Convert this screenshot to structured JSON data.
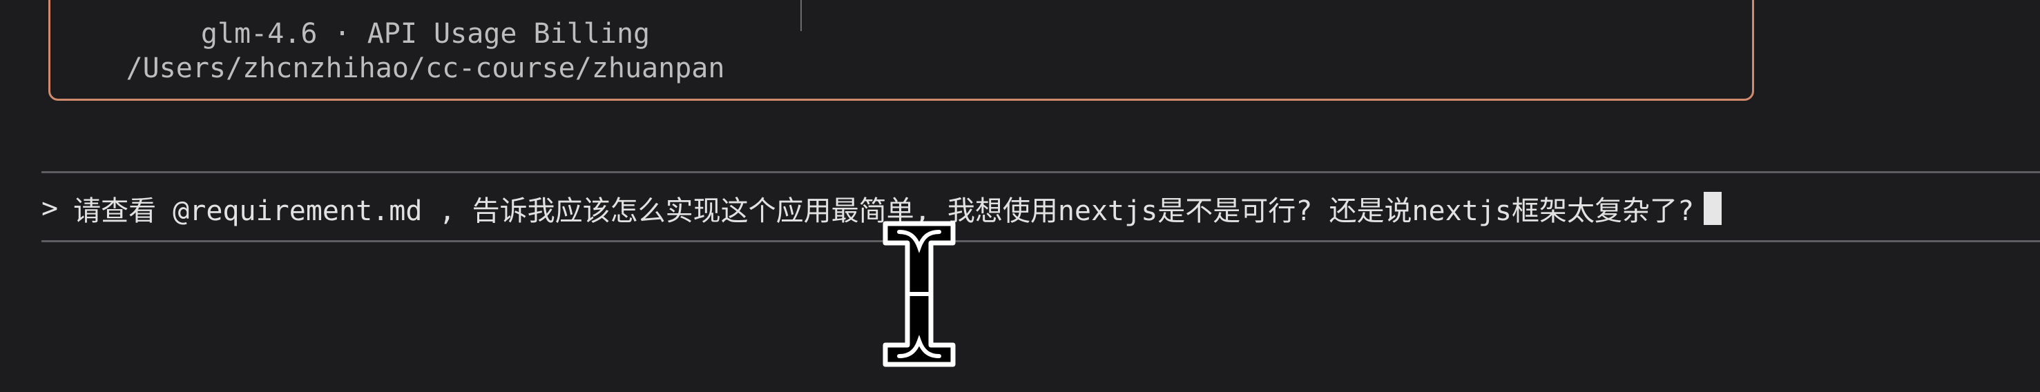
{
  "header": {
    "model_line": "glm-4.6 · API Usage Billing",
    "path_line": "/Users/zhcnzhihao/cc-course/zhuanpan"
  },
  "prompt": {
    "symbol": ">",
    "input_text": "请查看 @requirement.md , 告诉我应该怎么实现这个应用最简单, 我想使用nextjs是不是可行? 还是说nextjs框架太复杂了?"
  },
  "icons": {
    "mouse_cursor": "text-ibeam-cursor-icon"
  },
  "colors": {
    "background": "#1c1c1e",
    "box_border": "#d08a6e",
    "text": "#e2e2e2",
    "muted_text": "#bdbdbd",
    "rule": "#5e5e62"
  }
}
